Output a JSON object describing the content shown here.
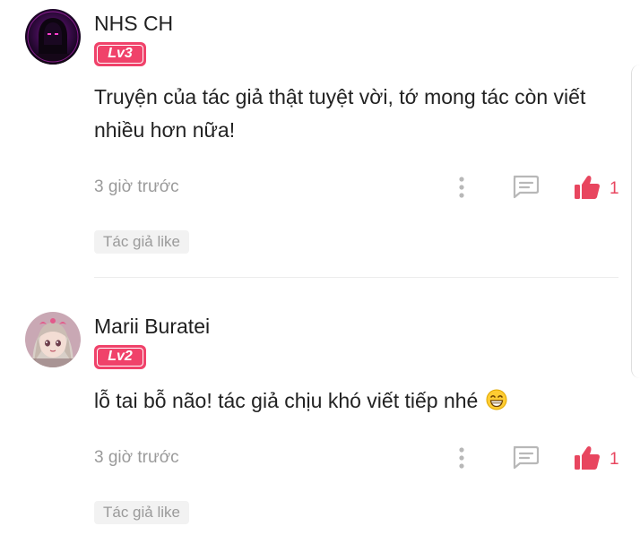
{
  "comments": [
    {
      "username": "NHS CH",
      "level": "Lv3",
      "text": "Truyện của tác giả thật tuyệt vời, tớ mong tác còn viết nhiều hơn nữa!",
      "timestamp": "3 giờ trước",
      "like_count": "1",
      "author_like_label": "Tác giả like",
      "avatar_icon": "hooded-figure-avatar"
    },
    {
      "username": "Marii Buratei",
      "level": "Lv2",
      "text": "lỗ tai bỗ não! tác giả chịu khó viết tiếp nhé",
      "emoji": "grinning-face-emoji",
      "timestamp": "3 giờ trước",
      "like_count": "1",
      "author_like_label": "Tác giả like",
      "avatar_icon": "anime-girl-avatar"
    }
  ],
  "colors": {
    "accent": "#f0426a",
    "like": "#e8465f",
    "muted_text": "#9a9a9a",
    "tag_bg": "#f2f2f2"
  },
  "icons": {
    "more": "more-vertical-icon",
    "reply": "comment-reply-icon",
    "like": "thumbs-up-icon"
  }
}
